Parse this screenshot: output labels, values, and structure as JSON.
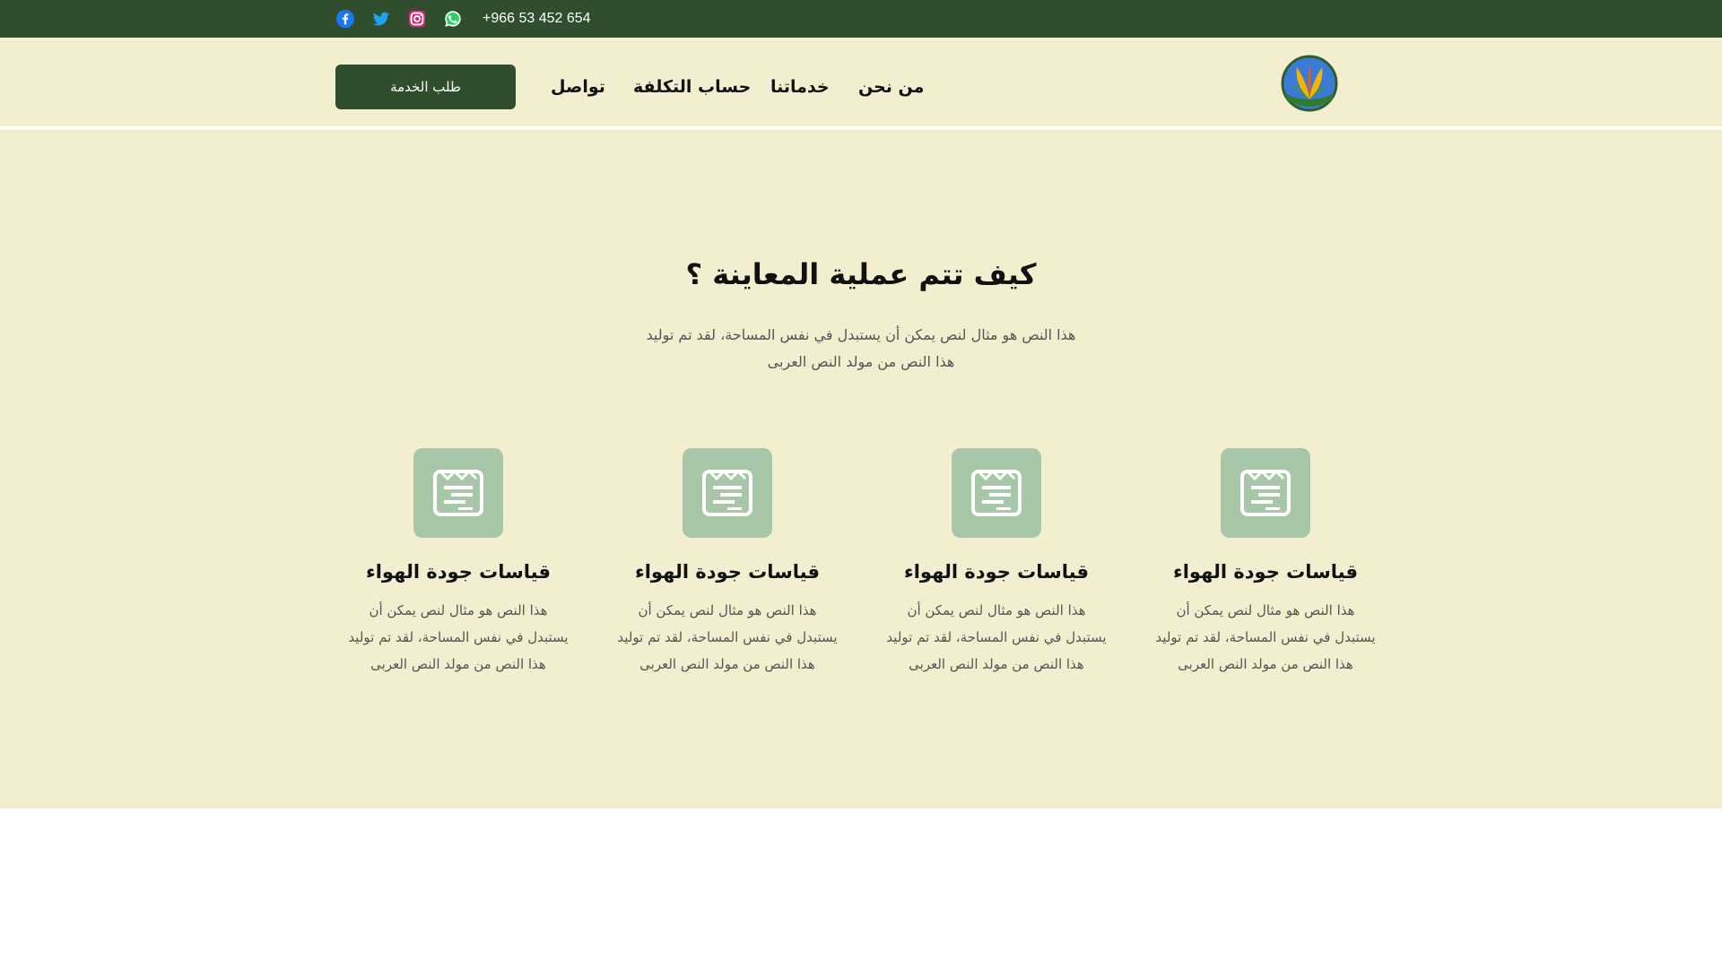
{
  "topbar": {
    "phone": "+966 53 452 654",
    "icons": [
      "facebook-icon",
      "twitter-icon",
      "instagram-icon",
      "whatsapp-icon"
    ],
    "colors": {
      "background": "#304e2e",
      "text": "#ffffff"
    }
  },
  "header": {
    "cta_label": "طلب الخدمة",
    "nav": {
      "contact": "تواصل",
      "cost": "حساب التكلفة",
      "services": "خدماتنا",
      "about": "من نحن"
    },
    "logo_icon": "logo-icon"
  },
  "section": {
    "title": "كيف تتم عملية المعاينة ؟",
    "intro": [
      "هذا النص هو مثال لنص يمكن أن يستبدل في نفس المساحة، لقد تم توليد",
      "هذا النص من مولد النص العربى"
    ],
    "cards": [
      {
        "icon": "document-icon",
        "title": "قياسات جودة الهواء",
        "lines": [
          "هذا النص هو مثال لنص يمكن أن",
          "يستبدل في نفس المساحة، لقد تم توليد",
          "هذا النص من مولد النص العربى"
        ]
      },
      {
        "icon": "document-icon",
        "title": "قياسات جودة الهواء",
        "lines": [
          "هذا النص هو مثال لنص يمكن أن",
          "يستبدل في نفس المساحة، لقد تم توليد",
          "هذا النص من مولد النص العربى"
        ]
      },
      {
        "icon": "document-icon",
        "title": "قياسات جودة الهواء",
        "lines": [
          "هذا النص هو مثال لنص يمكن أن",
          "يستبدل في نفس المساحة، لقد تم توليد",
          "هذا النص من مولد النص العربى"
        ]
      },
      {
        "icon": "document-icon",
        "title": "قياسات جودة الهواء",
        "lines": [
          "هذا النص هو مثال لنص يمكن أن",
          "يستبدل في نفس المساحة، لقد تم توليد",
          "هذا النص من مولد النص العربى"
        ]
      }
    ],
    "colors": {
      "background": "#f2eecf",
      "icon_tile": "#a8c6a8",
      "accent": "#304e2e"
    }
  }
}
